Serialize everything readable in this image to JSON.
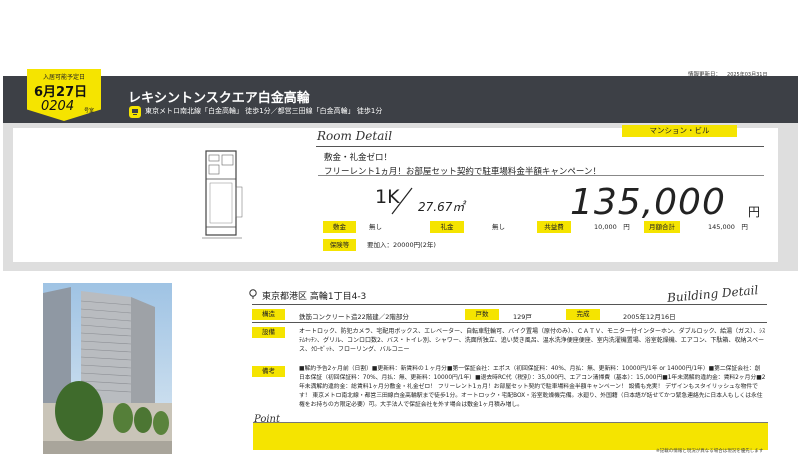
{
  "info": {
    "label": "情報更新日：",
    "date": "2025年03月31日"
  },
  "badge": {
    "caption": "入居可能予定日",
    "date": "6月27日",
    "room_number": "0204",
    "room_suffix": "号室"
  },
  "header": {
    "title": "レキシントンスクエア白金高輪",
    "access": "東京メトロ南北線「白金高輪」 徒歩1分／都営三田線「白金高輪」 徒歩1分",
    "icon": "train-icon"
  },
  "room": {
    "section_label": "Room Detail",
    "type": "マンション・ビル",
    "catch1": "敷金・礼金ゼロ！",
    "catch2": "フリーレント1ヵ月！お部屋セット契約で駐車場料金半額キャンペーン！",
    "madori": "1K",
    "area": "27.67㎡",
    "rent": "135,000",
    "rent_unit": "円"
  },
  "fees": [
    {
      "label": "敷金",
      "value": "無し"
    },
    {
      "label": "礼金",
      "value": "無し"
    },
    {
      "label": "共益費",
      "value": "10,000　円"
    },
    {
      "label": "月額合計",
      "value": "145,000　円"
    }
  ],
  "hoken": {
    "label": "保険等",
    "value": "要加入：20000円(2年)"
  },
  "building": {
    "section_label": "Building Detail",
    "address": "東京都港区 高輪1丁目4-3",
    "structure_label": "構造",
    "structure": "鉄筋コンクリート造22階建／2階部分",
    "units_label": "戸数",
    "units": "129戸",
    "built_label": "完成",
    "built": "2005年12月16日",
    "equipment_label": "設備",
    "equipment": "オートロック、防犯カメラ、宅配用ボックス、エレベーター、自転車駐輪可、バイク置場（原付のみ）、ＣＡＴＶ、モニター付インターホン、ダブルロック、給湯（ガス）、ｼｽﾃﾑｷｯﾁﾝ、グリル、コンロ口数2、バス・トイレ別、シャワー、洗面所独立、追い焚き風呂、温水洗浄便座便座、室内洗濯機置場、浴室乾燥機、エアコン、下駄箱、収納スペース、ｸﾛｰｾﾞｯﾄ、フローリング、バルコニー",
    "notes_label": "備考",
    "notes": "■解約予告2ヶ月前（日割）■更新料：新賃料の１ヶ月分■第一保証会社：エポス（初回保証料：40%、月払：無、更新料：10000円/1年 or 14000円/1年）■第二保証会社：創日本保証（初回保証料：70%、月払：無、更新料：10000円/1年）■退去時RC代（税別）：35,000円、エアコン清掃費（基本）：15,000円■1年未満解約違約金：賃料2ヶ月分■2年未満解約違約金：総賃料1ヶ月分敷金・礼金ゼロ！ フリーレント1ヵ月！お部屋セット契約で駐車場料金半額キャンペーン！ 設備も充実！ デザインもスタイリッシュな物件です！ 東京メトロ南北線・都営三田線白金高輪駅まで徒歩1分。オートロック・宅配BOX・浴室乾燥機完備。水廻り、外国籍（日本語が話せてかつ緊急連絡先に日本人もしくは永住権をお持ちの方限定必要）可。大手法人で保証会社を外す場合は敷金1ヶ月積み増し。"
  },
  "point": {
    "label": "Point",
    "text": ""
  },
  "footnote": "※記載の情報と現況が異なる場合は現況を優先します"
}
